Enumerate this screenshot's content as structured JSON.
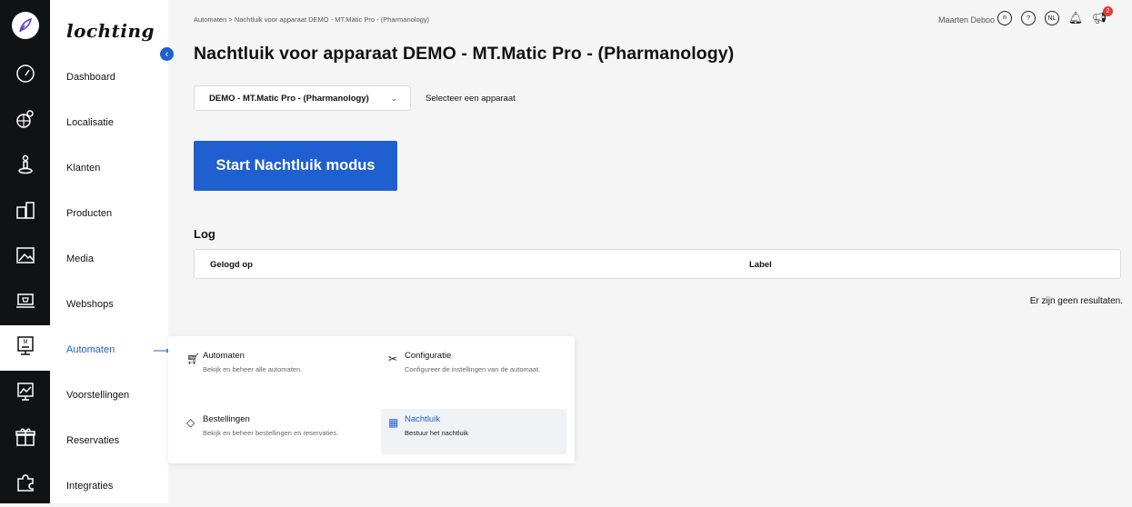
{
  "app": {
    "brand": "lochting"
  },
  "sidebar": {
    "items": [
      {
        "label": "Dashboard",
        "icon": "gauge-icon"
      },
      {
        "label": "Localisatie",
        "icon": "globe-pin-icon"
      },
      {
        "label": "Klanten",
        "icon": "person-pin-icon"
      },
      {
        "label": "Producten",
        "icon": "products-icon"
      },
      {
        "label": "Media",
        "icon": "image-icon"
      },
      {
        "label": "Webshops",
        "icon": "laptop-cart-icon"
      },
      {
        "label": "Automaten",
        "icon": "vending-machine-icon"
      },
      {
        "label": "Voorstellingen",
        "icon": "presentation-icon"
      },
      {
        "label": "Reservaties",
        "icon": "gift-icon"
      },
      {
        "label": "Integraties",
        "icon": "puzzle-icon"
      }
    ],
    "active_index": 6
  },
  "header": {
    "breadcrumb": "Automaten  >  Nachtluik voor apparaat DEMO - MT.Matic Pro - (Pharmanology)",
    "user_name": "Maarten Deboo",
    "language": "NL",
    "notification_count": "2"
  },
  "page": {
    "title": "Nachtluik voor apparaat DEMO - MT.Matic Pro - (Pharmanology)",
    "device_select": {
      "value": "DEMO - MT.Matic Pro - (Pharmanology)"
    },
    "device_select_hint": "Selecteer een apparaat",
    "start_button": "Start Nachtluik modus",
    "log_title": "Log",
    "log_columns": [
      "Gelogd op",
      "Label"
    ],
    "empty_text": "Er zijn geen resultaten."
  },
  "flyout": {
    "items": [
      {
        "title": "Automaten",
        "desc": "Bekijk en beheer alle automaten."
      },
      {
        "title": "Configuratie",
        "desc": "Configureer de instellingen van de automaat."
      },
      {
        "title": "Bestellingen",
        "desc": "Bekijk en beheer bestellingen en reservaties."
      },
      {
        "title": "Nachtluik",
        "desc": "Bestuur het nachtluik"
      }
    ]
  },
  "colors": {
    "accent": "#1f5fd0",
    "rail": "#111214",
    "badge": "#e53935"
  }
}
